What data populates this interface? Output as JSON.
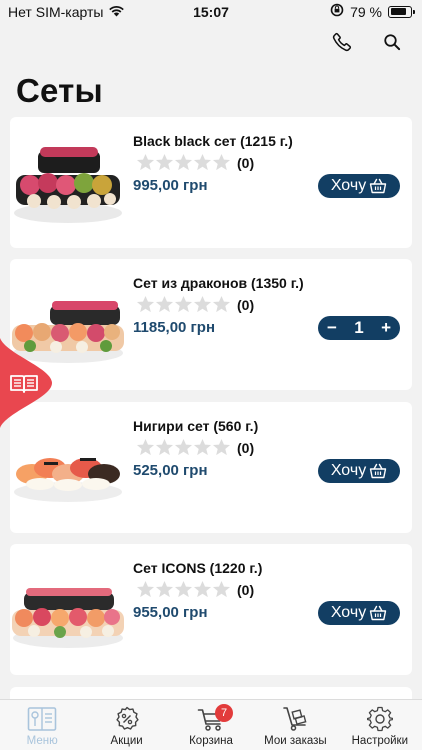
{
  "status_bar": {
    "carrier": "Нет SIM-карты",
    "time": "15:07",
    "battery": "79 %",
    "battery_level": 0.79
  },
  "header": {
    "title": "Сеты"
  },
  "products": [
    {
      "name": "Black black сет (1215 г.)",
      "rating_count": "(0)",
      "price": "995,00 грн",
      "button_label": "Хочу",
      "in_cart": false
    },
    {
      "name": "Сет из драконов (1350 г.)",
      "rating_count": "(0)",
      "price": "1185,00 грн",
      "in_cart": true,
      "quantity": "1",
      "minus": "−",
      "plus": "+"
    },
    {
      "name": "Нигири сет (560 г.)",
      "rating_count": "(0)",
      "price": "525,00 грн",
      "button_label": "Хочу",
      "in_cart": false
    },
    {
      "name": "Сет ICONS (1220 г.)",
      "rating_count": "(0)",
      "price": "955,00 грн",
      "button_label": "Хочу",
      "in_cart": false
    }
  ],
  "tab_bar": {
    "tabs": [
      {
        "label": "Меню",
        "icon": "menu-icon",
        "active": true
      },
      {
        "label": "Акции",
        "icon": "discount-icon",
        "active": false
      },
      {
        "label": "Корзина",
        "icon": "cart-icon",
        "active": false,
        "badge": "7"
      },
      {
        "label": "Мои заказы",
        "icon": "orders-icon",
        "active": false
      },
      {
        "label": "Настройки",
        "icon": "gear-icon",
        "active": false
      }
    ]
  },
  "colors": {
    "accent": "#123e63",
    "price": "#1f4a6e",
    "side_tab": "#e9474f",
    "badge": "#e23b3b",
    "active_tab": "#a9c4dc"
  }
}
